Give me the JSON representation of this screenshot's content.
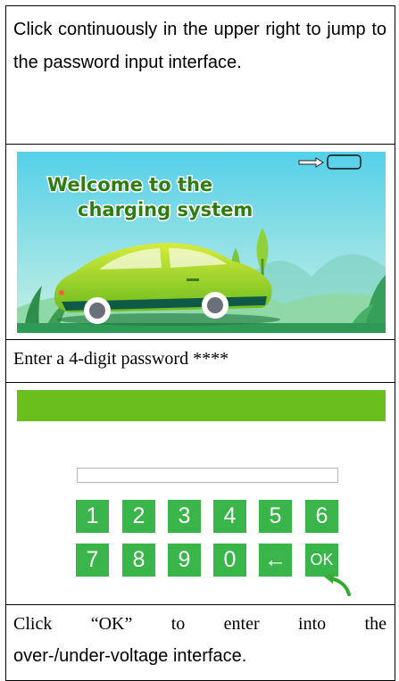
{
  "row1": {
    "instruction": "Click continuously in the upper right to jump to the password input interface."
  },
  "banner": {
    "title_line1": "Welcome to the",
    "title_line2": "charging system"
  },
  "row3": {
    "instruction": "Enter a 4-digit password ****"
  },
  "keypad": {
    "row1": [
      "1",
      "2",
      "3",
      "4",
      "5",
      "6"
    ],
    "row2": [
      "7",
      "8",
      "9",
      "0",
      "←",
      "OK"
    ]
  },
  "row5": {
    "words": [
      "Click",
      "“OK”",
      "to",
      "enter",
      "into",
      "the"
    ],
    "line2": "over-/under-voltage interface."
  },
  "colors": {
    "key_green": "#39b54a",
    "bar_green": "#6bbf1c",
    "title_green": "#2f7d12",
    "arrow_green": "#3aa934"
  }
}
